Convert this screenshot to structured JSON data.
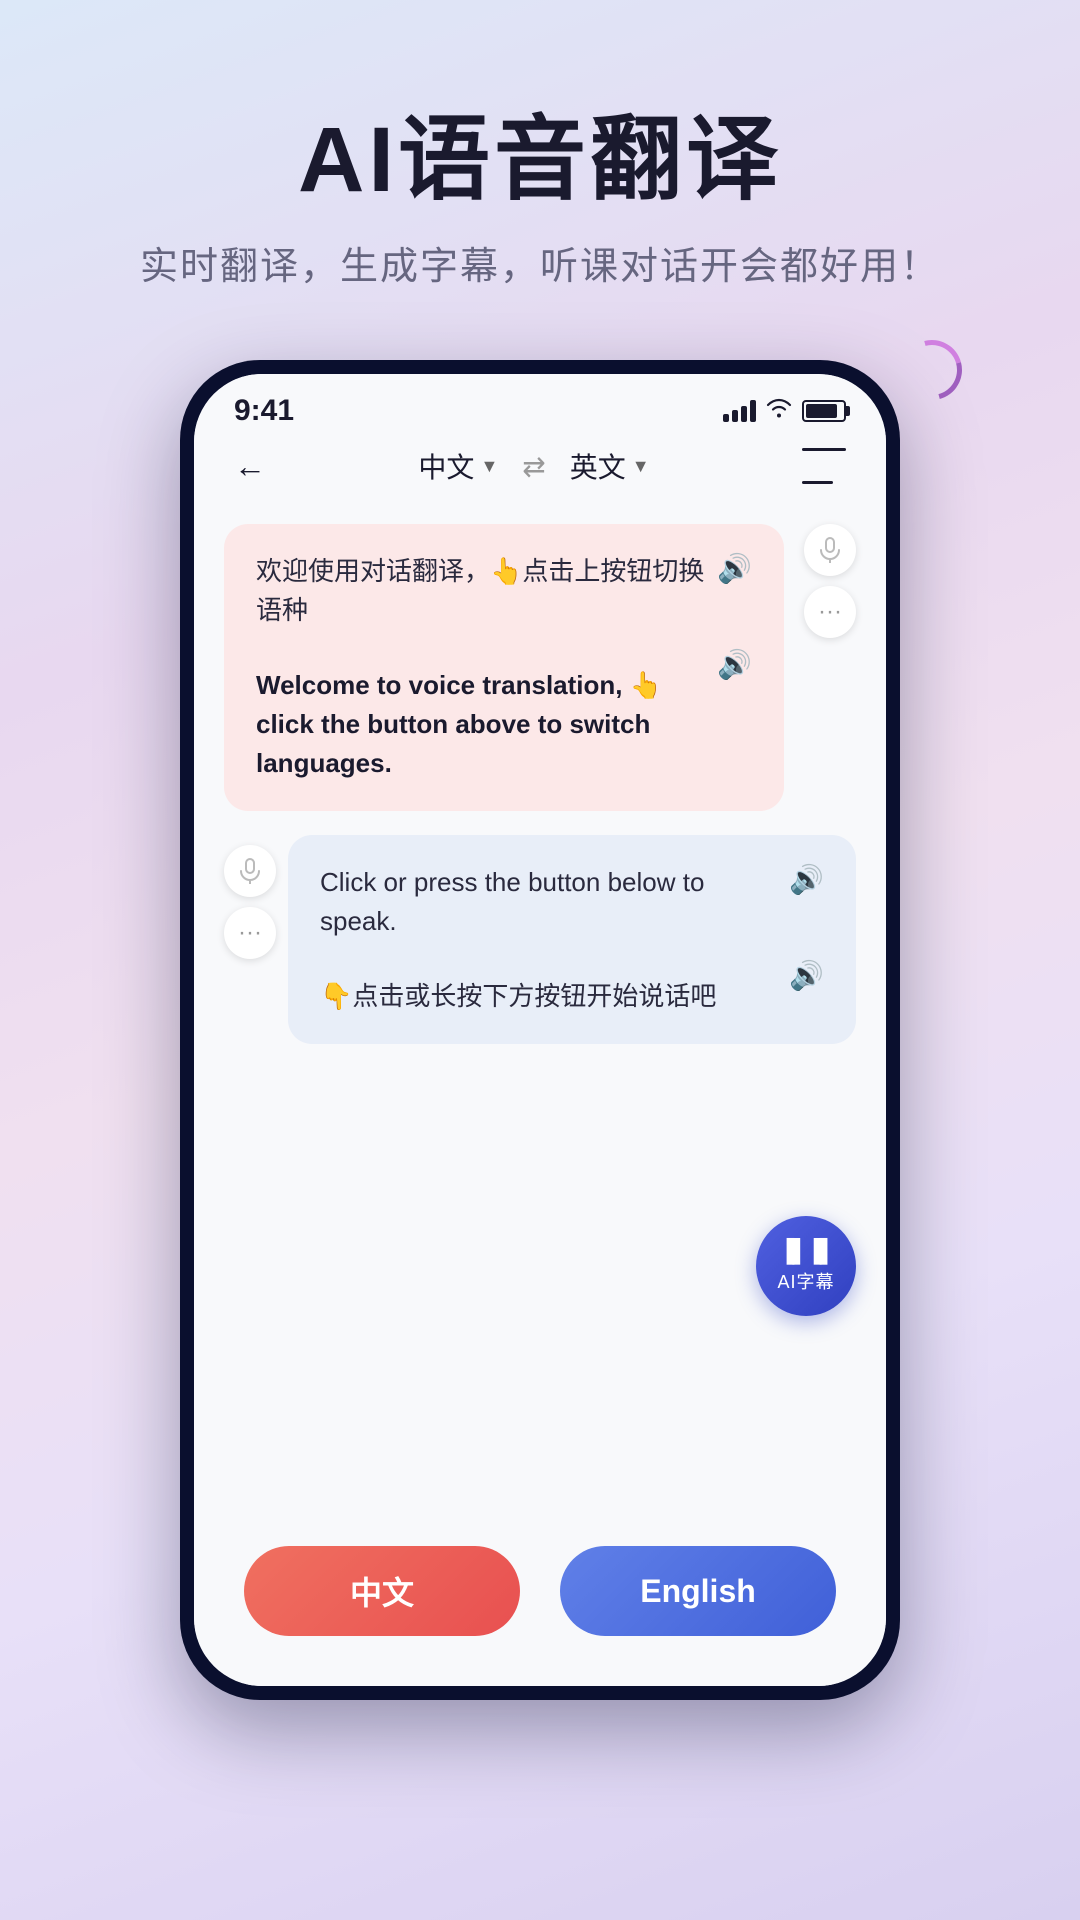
{
  "header": {
    "title": "AI语音翻译",
    "subtitle": "实时翻译，生成字幕，听课对话开会都好用！"
  },
  "phone": {
    "status_bar": {
      "time": "9:41"
    },
    "navbar": {
      "lang_left": "中文",
      "lang_right": "英文",
      "back_label": "←"
    },
    "chat": {
      "bubble_left": {
        "text_cn": "欢迎使用对话翻译，👆点击上按钮切换语种",
        "text_en": "Welcome to voice translation, 👆click the button above to switch languages."
      },
      "bubble_right": {
        "text_en": "Click or press the button below to speak.",
        "text_cn": "👇点击或长按下方按钮开始说话吧"
      }
    },
    "ai_caption_btn": {
      "label": "AI字幕"
    },
    "buttons": {
      "chinese": "中文",
      "english": "English"
    }
  }
}
